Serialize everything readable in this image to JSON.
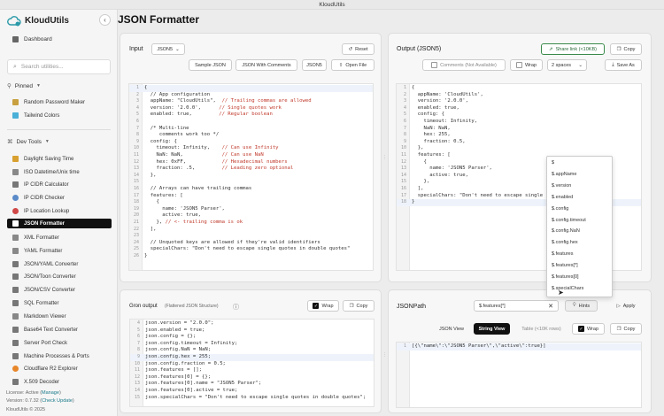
{
  "window_title": "KloudUtils",
  "app_name": "KloudUtils",
  "sidebar": {
    "dashboard": "Dashboard",
    "search_placeholder": "Search utilities...",
    "pinned_label": "Pinned",
    "pinned": [
      "Random Password Maker",
      "Tailwind Colors"
    ],
    "devtools_label": "Dev Tools",
    "tools": [
      "Daylight Saving Time",
      "ISO Datetime/Unix time",
      "IP CIDR Calculator",
      "IP CIDR Checker",
      "IP Location Lookup",
      "JSON Formatter",
      "XML Formatter",
      "YAML Formatter",
      "JSON/YAML Converter",
      "JSON/Toon Converter",
      "JSON/CSV Converter",
      "SQL Formatter",
      "Markdown Viewer",
      "Base64 Text Converter",
      "Server Port Check",
      "Machine Processes & Ports",
      "Cloudflare R2 Explorer",
      "X.509 Decoder"
    ],
    "license_prefix": "License: Active (",
    "license_link": "Manage",
    "license_suffix": ")",
    "version_prefix": "Version: 0.7.32 (",
    "version_link": "Check Update",
    "version_suffix": ")",
    "copyright": "KloudUtils © 2025"
  },
  "page_title": "JSON Formatter",
  "input_panel": {
    "label": "Input",
    "format_select": "JSON5",
    "reset": "Reset",
    "sample_json": "Sample JSON",
    "json_with_comments": "JSON With Comments",
    "json5": "JSON5",
    "open_file": "Open File",
    "lines": [
      {
        "n": "1",
        "t": "{",
        "c": ""
      },
      {
        "n": "2",
        "t": "  // App configuration",
        "c": "cm"
      },
      {
        "n": "3",
        "t": "  appName: \"CloudUtils\",  // Trailing commas are allowed",
        "c": ""
      },
      {
        "n": "4",
        "t": "  version: '2.0.0',      // Single quotes work",
        "c": ""
      },
      {
        "n": "5",
        "t": "  enabled: true,         // Regular boolean",
        "c": ""
      },
      {
        "n": "6",
        "t": "",
        "c": ""
      },
      {
        "n": "7",
        "t": "  /* Multi-line",
        "c": "cm"
      },
      {
        "n": "8",
        "t": "     comments work too */",
        "c": "cm"
      },
      {
        "n": "9",
        "t": "  config: {",
        "c": ""
      },
      {
        "n": "10",
        "t": "    timeout: Infinity,    // Can use Infinity",
        "c": ""
      },
      {
        "n": "11",
        "t": "    NaN: NaN,             // Can use NaN",
        "c": ""
      },
      {
        "n": "12",
        "t": "    hex: 0xFF,            // Hexadecimal numbers",
        "c": ""
      },
      {
        "n": "13",
        "t": "    fraction: .5,         // Leading zero optional",
        "c": ""
      },
      {
        "n": "14",
        "t": "  },",
        "c": ""
      },
      {
        "n": "15",
        "t": "",
        "c": ""
      },
      {
        "n": "16",
        "t": "  // Arrays can have trailing commas",
        "c": "cm"
      },
      {
        "n": "17",
        "t": "  features: [",
        "c": ""
      },
      {
        "n": "18",
        "t": "    {",
        "c": ""
      },
      {
        "n": "19",
        "t": "      name: 'JSON5 Parser',",
        "c": ""
      },
      {
        "n": "20",
        "t": "      active: true,",
        "c": ""
      },
      {
        "n": "21",
        "t": "    }, // <- trailing comma is ok",
        "c": ""
      },
      {
        "n": "22",
        "t": "  ],",
        "c": ""
      },
      {
        "n": "23",
        "t": "",
        "c": ""
      },
      {
        "n": "24",
        "t": "  // Unquoted keys are allowed if they're valid identifiers",
        "c": "cm"
      },
      {
        "n": "25",
        "t": "  specialChars: \"Don't need to escape single quotes in double quotes\"",
        "c": ""
      },
      {
        "n": "26",
        "t": "}",
        "c": ""
      }
    ]
  },
  "output_panel": {
    "label": "Output (JSON5)",
    "share_link": "Share link (<10KB)",
    "copy": "Copy",
    "comments": "Comments (Not Available)",
    "wrap": "Wrap",
    "indent": "2 spaces",
    "save_as": "Save As",
    "lines": [
      {
        "n": "1",
        "t": "{"
      },
      {
        "n": "2",
        "t": "  appName: 'CloudUtils',"
      },
      {
        "n": "3",
        "t": "  version: '2.0.0',"
      },
      {
        "n": "4",
        "t": "  enabled: true,"
      },
      {
        "n": "5",
        "t": "  config: {"
      },
      {
        "n": "6",
        "t": "    timeout: Infinity,"
      },
      {
        "n": "7",
        "t": "    NaN: NaN,"
      },
      {
        "n": "8",
        "t": "    hex: 255,"
      },
      {
        "n": "9",
        "t": "    fraction: 0.5,"
      },
      {
        "n": "10",
        "t": "  },"
      },
      {
        "n": "11",
        "t": "  features: ["
      },
      {
        "n": "12",
        "t": "    {"
      },
      {
        "n": "13",
        "t": "      name: 'JSON5 Parser',"
      },
      {
        "n": "14",
        "t": "      active: true,"
      },
      {
        "n": "15",
        "t": "    },"
      },
      {
        "n": "16",
        "t": "  ],"
      },
      {
        "n": "17",
        "t": "  specialChars: \"Don't need to escape single"
      },
      {
        "n": "18",
        "t": "}"
      }
    ]
  },
  "autocomplete": [
    "$",
    "$.appName",
    "$.version",
    "$.enabled",
    "$.config",
    "$.config.timeout",
    "$.config.NaN",
    "$.config.hex",
    "$.features",
    "$.features[*]",
    "$.features[0]",
    "$.specialChars"
  ],
  "gron_panel": {
    "label": "Gron output",
    "sublabel": "(Flattened JSON Structure)",
    "wrap": "Wrap",
    "copy": "Copy",
    "lines": [
      {
        "n": "4",
        "t": "json.version = \"2.0.0\";"
      },
      {
        "n": "5",
        "t": "json.enabled = true;"
      },
      {
        "n": "6",
        "t": "json.config = {};"
      },
      {
        "n": "7",
        "t": "json.config.timeout = Infinity;"
      },
      {
        "n": "8",
        "t": "json.config.NaN = NaN;"
      },
      {
        "n": "9",
        "t": "json.config.hex = 255;"
      },
      {
        "n": "10",
        "t": "json.config.fraction = 0.5;"
      },
      {
        "n": "11",
        "t": "json.features = [];"
      },
      {
        "n": "12",
        "t": "json.features[0] = {};"
      },
      {
        "n": "13",
        "t": "json.features[0].name = \"JSON5 Parser\";"
      },
      {
        "n": "14",
        "t": "json.features[0].active = true;"
      },
      {
        "n": "15",
        "t": "json.specialChars = \"Don't need to escape single quotes in double quotes\";"
      }
    ]
  },
  "jsonpath_panel": {
    "label": "JSONPath",
    "query": "$.features[*]",
    "hints": "Hints",
    "apply": "Apply",
    "json_view": "JSON View",
    "string_view": "String View",
    "table": "Table (<10K rows)",
    "wrap": "Wrap",
    "copy": "Copy",
    "result_line_n": "1",
    "result": "[{\\\"name\\\":\\\"JSON5 Parser\\\",\\\"active\\\":true}]"
  }
}
